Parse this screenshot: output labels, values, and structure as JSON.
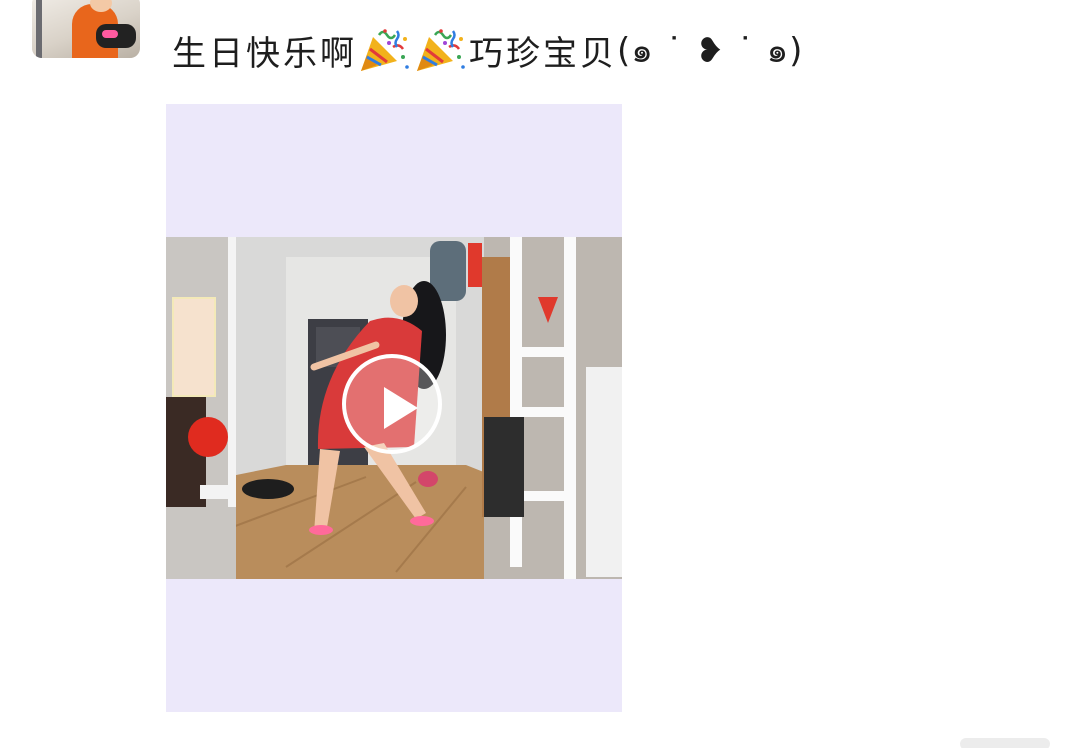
{
  "post": {
    "author_avatar": "user-avatar",
    "text_before": "生日快乐啊",
    "emoji": [
      "party-popper-icon",
      "party-popper-icon"
    ],
    "text_after": "巧珍宝贝",
    "kaomoji": "(๑ ˙ ❥ ˙ ๑)",
    "media": {
      "type": "video",
      "play_icon": "play-icon"
    }
  }
}
